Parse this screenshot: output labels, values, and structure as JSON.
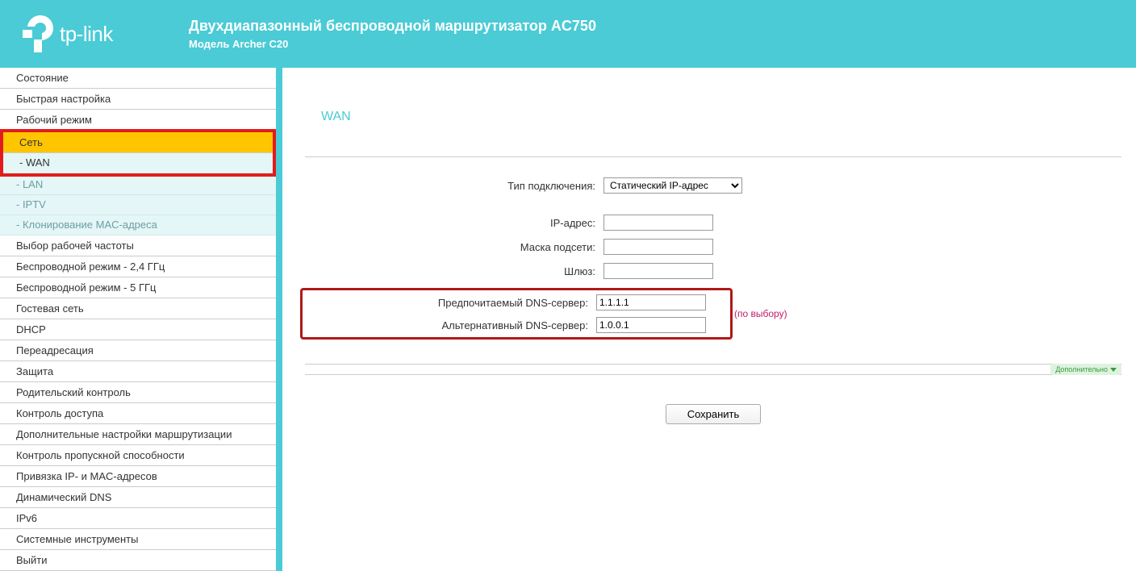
{
  "header": {
    "brand": "tp-link",
    "title": "Двухдиапазонный беспроводной маршрутизатор AC750",
    "subtitle": "Модель Archer C20"
  },
  "sidebar": {
    "items": [
      {
        "label": "Состояние"
      },
      {
        "label": "Быстрая настройка"
      },
      {
        "label": "Рабочий режим"
      },
      {
        "label": "Сеть",
        "selected": true
      },
      {
        "label": "Выбор рабочей частоты"
      },
      {
        "label": "Беспроводной режим - 2,4 ГГц"
      },
      {
        "label": "Беспроводной режим - 5 ГГц"
      },
      {
        "label": "Гостевая сеть"
      },
      {
        "label": "DHCP"
      },
      {
        "label": "Переадресация"
      },
      {
        "label": "Защита"
      },
      {
        "label": "Родительский контроль"
      },
      {
        "label": "Контроль доступа"
      },
      {
        "label": "Дополнительные настройки маршрутизации"
      },
      {
        "label": "Контроль пропускной способности"
      },
      {
        "label": "Привязка IP- и MAC-адресов"
      },
      {
        "label": "Динамический DNS"
      },
      {
        "label": "IPv6"
      },
      {
        "label": "Системные инструменты"
      },
      {
        "label": "Выйти"
      }
    ],
    "sub": [
      {
        "label": "- WAN",
        "active": true
      },
      {
        "label": "- LAN"
      },
      {
        "label": "- IPTV"
      },
      {
        "label": "- Клонирование MAC-адреса"
      }
    ]
  },
  "page": {
    "title": "WAN",
    "connection_type_label": "Тип подключения:",
    "connection_type_value": "Статический IP-адрес",
    "ip_label": "IP-адрес:",
    "ip_value": "",
    "mask_label": "Маска подсети:",
    "mask_value": "",
    "gateway_label": "Шлюз:",
    "gateway_value": "",
    "dns1_label": "Предпочитаемый DNS-сервер:",
    "dns1_value": "1.1.1.1",
    "dns2_label": "Альтернативный DNS-сервер:",
    "dns2_value": "1.0.0.1",
    "optional_note": "(по выбору)",
    "more_label": "Дополнительно",
    "save_label": "Сохранить"
  }
}
